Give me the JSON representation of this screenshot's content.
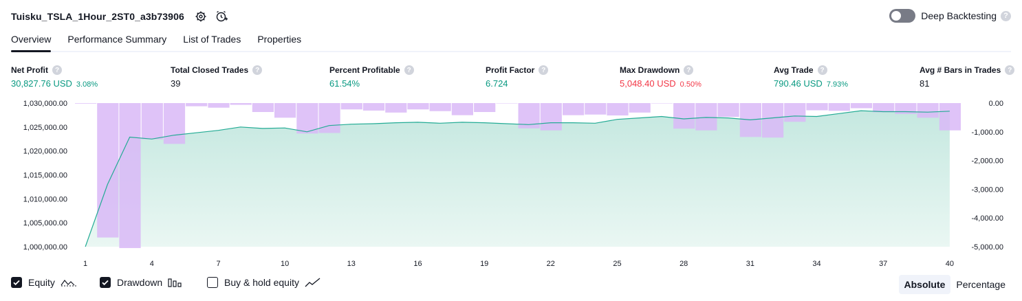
{
  "header": {
    "title": "Tuisku_TSLA_1Hour_2ST0_a3b73906",
    "deep_backtesting_label": "Deep Backtesting",
    "help_glyph": "?"
  },
  "tabs": [
    {
      "label": "Overview",
      "active": true
    },
    {
      "label": "Performance Summary"
    },
    {
      "label": "List of Trades"
    },
    {
      "label": "Properties"
    }
  ],
  "metrics": {
    "net_profit": {
      "label": "Net Profit",
      "value": "30,827.76 USD",
      "sub": "3.08%"
    },
    "total_closed_trades": {
      "label": "Total Closed Trades",
      "value": "39"
    },
    "percent_profitable": {
      "label": "Percent Profitable",
      "value": "61.54%"
    },
    "profit_factor": {
      "label": "Profit Factor",
      "value": "6.724"
    },
    "max_drawdown": {
      "label": "Max Drawdown",
      "value": "5,048.40 USD",
      "sub": "0.50%"
    },
    "avg_trade": {
      "label": "Avg Trade",
      "value": "790.46 USD",
      "sub": "7.93%"
    },
    "avg_bars": {
      "label": "Avg # Bars in Trades",
      "value": "81"
    }
  },
  "legend": {
    "equity": "Equity",
    "drawdown": "Drawdown",
    "buy_hold": "Buy & hold equity",
    "equity_checked": true,
    "drawdown_checked": true,
    "buy_hold_checked": false
  },
  "modes": {
    "absolute": "Absolute",
    "percentage": "Percentage",
    "selected": "absolute"
  },
  "colors": {
    "equity_line": "#22ab94",
    "equity_fill": "#c5e8e0",
    "drawdown_fill": "#d9b8f7",
    "positive": "#089981",
    "negative": "#f23645",
    "text": "#131722",
    "axis_text": "#131722"
  },
  "chart_data": {
    "type": "area",
    "x": [
      1,
      2,
      3,
      4,
      5,
      6,
      7,
      8,
      9,
      10,
      11,
      12,
      13,
      14,
      15,
      16,
      17,
      18,
      19,
      20,
      21,
      22,
      23,
      24,
      25,
      26,
      27,
      28,
      29,
      30,
      31,
      32,
      33,
      34,
      35,
      36,
      37,
      38,
      39,
      40
    ],
    "xticks": [
      "1",
      "4",
      "7",
      "10",
      "13",
      "16",
      "19",
      "22",
      "25",
      "28",
      "31",
      "34",
      "37",
      "40"
    ],
    "series": [
      {
        "name": "Equity",
        "axis": "left",
        "values": [
          1000000,
          1013000,
          1022900,
          1022500,
          1023300,
          1023800,
          1024300,
          1025000,
          1024700,
          1024800,
          1024000,
          1025300,
          1025600,
          1025700,
          1025900,
          1026000,
          1025800,
          1026000,
          1025900,
          1025700,
          1025500,
          1025900,
          1025900,
          1025800,
          1026600,
          1026900,
          1027200,
          1026700,
          1027000,
          1026900,
          1026500,
          1026900,
          1027300,
          1027200,
          1027800,
          1028400,
          1028200,
          1028200,
          1028100,
          1028300
        ]
      },
      {
        "name": "Drawdown",
        "axis": "right",
        "values": [
          -20,
          -4680,
          -5048,
          -1260,
          -1420,
          -110,
          -160,
          -60,
          -310,
          -510,
          -1060,
          -1040,
          -220,
          -260,
          -330,
          -220,
          -280,
          -420,
          -310,
          0,
          -880,
          -950,
          -420,
          -400,
          -430,
          -330,
          0,
          -890,
          -950,
          -480,
          -1180,
          -1200,
          -650,
          -250,
          -270,
          -180,
          -320,
          -380,
          -510,
          -950
        ]
      }
    ],
    "left_axis": {
      "ticks": [
        "1,030,000.00",
        "1,025,000.00",
        "1,020,000.00",
        "1,015,000.00",
        "1,010,000.00",
        "1,005,000.00",
        "1,000,000.00"
      ],
      "ylim": [
        1000000,
        1030000
      ]
    },
    "right_axis": {
      "ticks": [
        "0.00",
        "-1,000.00",
        "-2,000.00",
        "-3,000.00",
        "-4,000.00",
        "-5,000.00"
      ],
      "ylim": [
        -5000,
        0
      ]
    }
  }
}
